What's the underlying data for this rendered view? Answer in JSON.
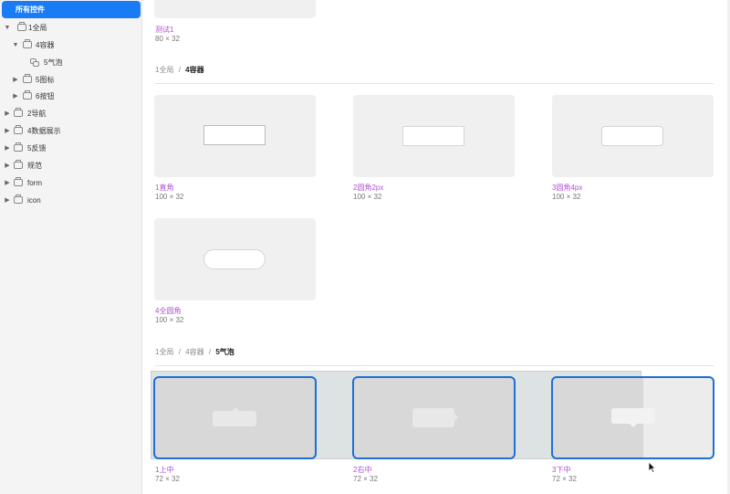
{
  "sidebar": {
    "all_controls": "所有控件",
    "tree": [
      {
        "label": "1全局",
        "level": 0,
        "expanded": true
      },
      {
        "label": "4容器",
        "level": 1,
        "expanded": true
      },
      {
        "label": "5气泡",
        "level": 2,
        "icon": "bubble"
      },
      {
        "label": "5图标",
        "level": 1,
        "expanded": false
      },
      {
        "label": "6按钮",
        "level": 1,
        "expanded": false
      },
      {
        "label": "2导航",
        "level": 0,
        "expanded": false
      },
      {
        "label": "4数据展示",
        "level": 0,
        "expanded": false
      },
      {
        "label": "5反馈",
        "level": 0,
        "expanded": false
      },
      {
        "label": "规范",
        "level": 0,
        "expanded": false
      },
      {
        "label": "form",
        "level": 0,
        "expanded": false
      },
      {
        "label": "icon",
        "level": 0,
        "expanded": false
      }
    ]
  },
  "main": {
    "top_item": {
      "name": "测试1",
      "size": "80 × 32"
    },
    "section1": {
      "crumb": [
        "1全局",
        "4容器"
      ],
      "sep": "/",
      "items": [
        {
          "name": "1直角",
          "size": "100 × 32"
        },
        {
          "name": "2圆角2px",
          "size": "100 × 32"
        },
        {
          "name": "3圆角4px",
          "size": "100 × 32"
        },
        {
          "name": "4全圆角",
          "size": "100 × 32"
        }
      ]
    },
    "section2": {
      "crumb": [
        "1全局",
        "4容器",
        "5气泡"
      ],
      "sep": "/",
      "items": [
        {
          "name": "1上中",
          "size": "72 × 32"
        },
        {
          "name": "2右中",
          "size": "72 × 32"
        },
        {
          "name": "3下中",
          "size": "72 × 32"
        }
      ]
    }
  },
  "colors": {
    "accent": "#1a7cf4",
    "component_name": "#b151d6",
    "selection": "#1e6fd9"
  }
}
